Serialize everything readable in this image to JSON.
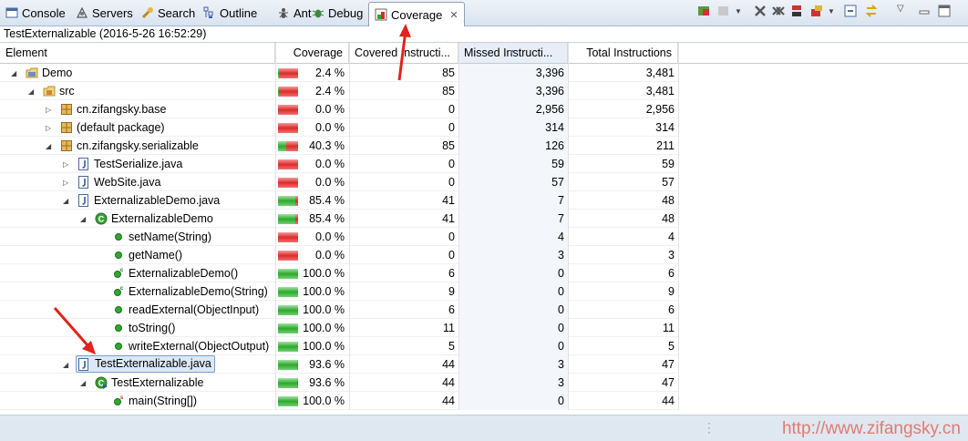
{
  "tabs": [
    {
      "label": "Console",
      "icon": "console-icon"
    },
    {
      "label": "Servers",
      "icon": "servers-icon"
    },
    {
      "label": "Search",
      "icon": "search-icon"
    },
    {
      "label": "Outline",
      "icon": "outline-icon"
    },
    {
      "label": "Ant",
      "icon": "ant-icon"
    },
    {
      "label": "Debug",
      "icon": "debug-icon"
    },
    {
      "label": "Coverage",
      "icon": "coverage-icon",
      "close": "✕"
    }
  ],
  "session": "TestExternalizable (2016-5-26 16:52:29)",
  "columns": {
    "element": "Element",
    "coverage": "Coverage",
    "covered": "Covered Instructi...",
    "missed": "Missed Instructi...",
    "total": "Total Instructions"
  },
  "rows": [
    {
      "name": "Demo",
      "coverage": "2.4 %",
      "covered": "85",
      "missed": "3,396",
      "total": "3,481",
      "icon": "project-icon",
      "pct": 2.4
    },
    {
      "name": "src",
      "coverage": "2.4 %",
      "covered": "85",
      "missed": "3,396",
      "total": "3,481",
      "icon": "source-folder-icon",
      "pct": 2.4
    },
    {
      "name": "cn.zifangsky.base",
      "coverage": "0.0 %",
      "covered": "0",
      "missed": "2,956",
      "total": "2,956",
      "icon": "package-icon",
      "pct": 0
    },
    {
      "name": "(default package)",
      "coverage": "0.0 %",
      "covered": "0",
      "missed": "314",
      "total": "314",
      "icon": "package-icon",
      "pct": 0
    },
    {
      "name": "cn.zifangsky.serializable",
      "coverage": "40.3 %",
      "covered": "85",
      "missed": "126",
      "total": "211",
      "icon": "package-icon",
      "pct": 40.3
    },
    {
      "name": "TestSerialize.java",
      "coverage": "0.0 %",
      "covered": "0",
      "missed": "59",
      "total": "59",
      "icon": "java-file-icon",
      "pct": 0
    },
    {
      "name": "WebSite.java",
      "coverage": "0.0 %",
      "covered": "0",
      "missed": "57",
      "total": "57",
      "icon": "java-file-icon",
      "pct": 0
    },
    {
      "name": "ExternalizableDemo.java",
      "coverage": "85.4 %",
      "covered": "41",
      "missed": "7",
      "total": "48",
      "icon": "java-file-icon",
      "pct": 85.4
    },
    {
      "name": "ExternalizableDemo",
      "coverage": "85.4 %",
      "covered": "41",
      "missed": "7",
      "total": "48",
      "icon": "class-icon",
      "pct": 85.4
    },
    {
      "name": "setName(String)",
      "coverage": "0.0 %",
      "covered": "0",
      "missed": "4",
      "total": "4",
      "icon": "method-icon",
      "pct": 0
    },
    {
      "name": "getName()",
      "coverage": "0.0 %",
      "covered": "0",
      "missed": "3",
      "total": "3",
      "icon": "method-icon",
      "pct": 0
    },
    {
      "name": "ExternalizableDemo()",
      "coverage": "100.0 %",
      "covered": "6",
      "missed": "0",
      "total": "6",
      "icon": "constructor-icon",
      "pct": 100
    },
    {
      "name": "ExternalizableDemo(String)",
      "coverage": "100.0 %",
      "covered": "9",
      "missed": "0",
      "total": "9",
      "icon": "constructor-icon",
      "pct": 100
    },
    {
      "name": "readExternal(ObjectInput)",
      "coverage": "100.0 %",
      "covered": "6",
      "missed": "0",
      "total": "6",
      "icon": "method-icon",
      "pct": 100
    },
    {
      "name": "toString()",
      "coverage": "100.0 %",
      "covered": "11",
      "missed": "0",
      "total": "11",
      "icon": "method-icon",
      "pct": 100
    },
    {
      "name": "writeExternal(ObjectOutput)",
      "coverage": "100.0 %",
      "covered": "5",
      "missed": "0",
      "total": "5",
      "icon": "method-icon",
      "pct": 100
    },
    {
      "name": "TestExternalizable.java",
      "coverage": "93.6 %",
      "covered": "44",
      "missed": "3",
      "total": "47",
      "icon": "java-file-icon",
      "pct": 93.6
    },
    {
      "name": "TestExternalizable",
      "coverage": "93.6 %",
      "covered": "44",
      "missed": "3",
      "total": "47",
      "icon": "main-class-icon",
      "pct": 93.6
    },
    {
      "name": "main(String[])",
      "coverage": "100.0 %",
      "covered": "44",
      "missed": "0",
      "total": "44",
      "icon": "static-method-icon",
      "pct": 100
    }
  ],
  "watermark": "http://www.zifangsky.cn",
  "colors": {
    "annotation": "#e0231b",
    "covered": "#2ea82e",
    "missed": "#dd2a2a",
    "watermark": "#e07b72"
  }
}
